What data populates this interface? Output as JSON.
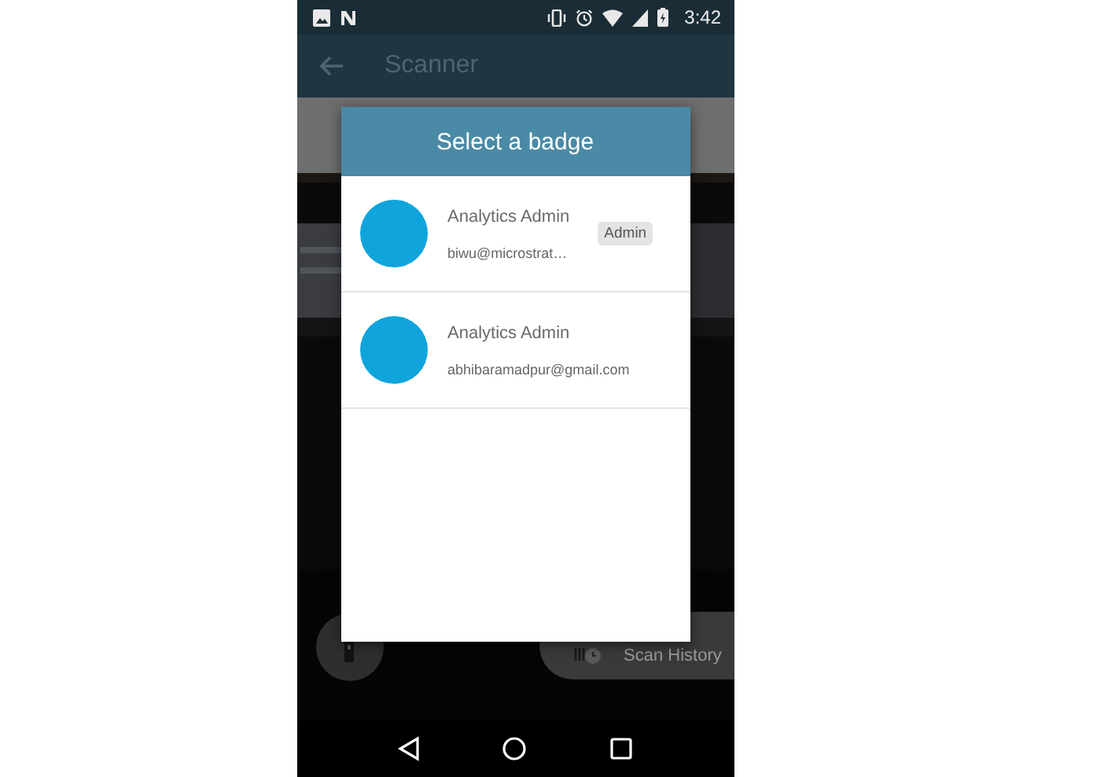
{
  "status_bar": {
    "time": "3:42"
  },
  "app_bar": {
    "title": "Scanner"
  },
  "scanner": {
    "scan_history_label": "Scan History"
  },
  "dialog": {
    "title": "Select a badge",
    "badges": [
      {
        "name": "Analytics Admin",
        "email": "biwu@microstrat…",
        "role": "Admin"
      },
      {
        "name": "Analytics Admin",
        "email": "abhibaramadpur@gmail.com"
      }
    ]
  }
}
